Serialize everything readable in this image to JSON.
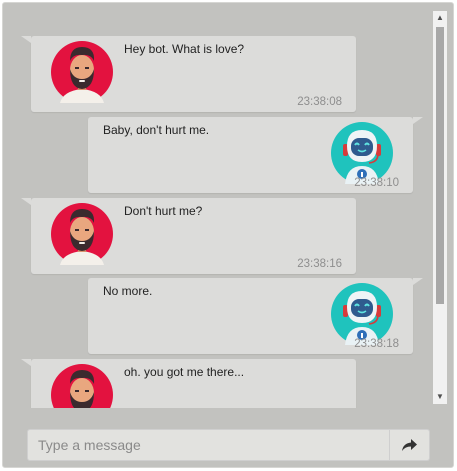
{
  "messages": [
    {
      "sender": "user",
      "text": "Hey bot. What is love?",
      "time": "23:38:08"
    },
    {
      "sender": "bot",
      "text": "Baby, don't hurt me.",
      "time": "23:38:10"
    },
    {
      "sender": "user",
      "text": "Don't hurt me?",
      "time": "23:38:16"
    },
    {
      "sender": "bot",
      "text": "No more.",
      "time": "23:38:18"
    },
    {
      "sender": "user",
      "text": "oh. you got me there...",
      "time": ""
    }
  ],
  "composer": {
    "placeholder": "Type a message",
    "send_icon": "share-arrow-icon"
  },
  "colors": {
    "background": "#c2c2bf",
    "bubble": "#dcdcda",
    "user_avatar_bg": "#e3123f",
    "bot_avatar_bg": "#1fc3bd",
    "bot_accent": "#d63b3b"
  }
}
